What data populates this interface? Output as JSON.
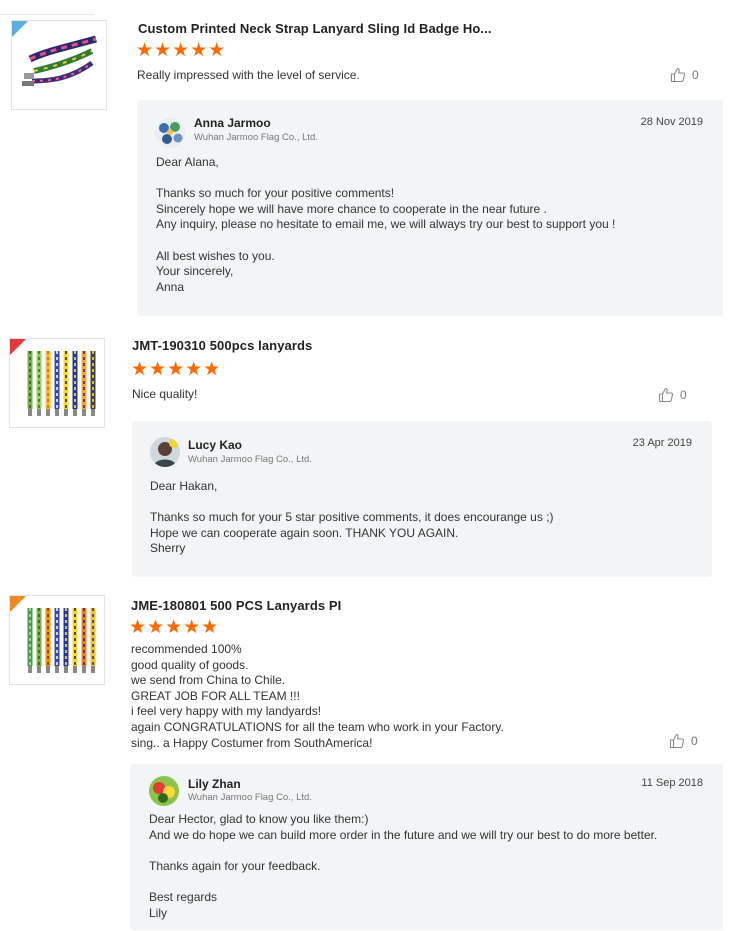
{
  "reviews": [
    {
      "product_title": "Custom Printed Neck Strap Lanyard Sling Id Badge Ho...",
      "rating": 5,
      "stars": "★★★★★",
      "comment": "Really impressed with the level of service.",
      "likes": "0",
      "reply": {
        "name": "Anna Jarmoo",
        "company": "Wuhan Jarmoo Flag Co., Ltd.",
        "date": "28 Nov 2019",
        "text": "Dear Alana,\n\nThanks so much for your positive comments!\nSincerely hope we will have more chance to cooperate in the near future .\nAny inquiry, please no hesitate to email me, we will always try our best to support you !\n\nAll best wishes to you.\nYour sincerely,\nAnna"
      }
    },
    {
      "product_title": "JMT-190310 500pcs lanyards",
      "rating": 5,
      "stars": "★★★★★",
      "comment": "Nice quality!",
      "likes": "0",
      "reply": {
        "name": "Lucy Kao",
        "company": "Wuhan Jarmoo Flag Co., Ltd.",
        "date": "23 Apr 2019",
        "text": "Dear Hakan,\n\nThanks so much for your 5 star positive comments, it  does encourange us ;)\nHope we can cooperate again soon.  THANK YOU AGAIN.\nSherry"
      }
    },
    {
      "product_title": "JME-180801 500 PCS Lanyards PI",
      "rating": 5,
      "stars": "★★★★★",
      "comment": "recommended 100%\ngood quality of goods.\nwe send from China to Chile.\nGREAT JOB FOR ALL TEAM !!!\ni feel very happy with my landyards!\nagain CONGRATULATIONS for all the team who work in your Factory.\nsing.. a Happy Costumer from SouthAmerica!",
      "likes": "0",
      "reply": {
        "name": "Lily Zhan",
        "company": "Wuhan Jarmoo Flag Co., Ltd.",
        "date": "11 Sep 2018",
        "text": "Dear Hector, glad to know you like them:)\nAnd we do hope we can build more order in the future and we will try our best to do more better.\n\nThanks again for your feedback.\n\nBest regards\nLily"
      }
    }
  ],
  "colors": {
    "star": "#ff6a00",
    "reply_bg": "#f3f4f6",
    "badge_blue": "#5aaee0",
    "badge_red": "#e4393c",
    "badge_orange": "#f08a24"
  },
  "icons": [
    "thumbs-up-icon",
    "star-icon",
    "avatar"
  ]
}
